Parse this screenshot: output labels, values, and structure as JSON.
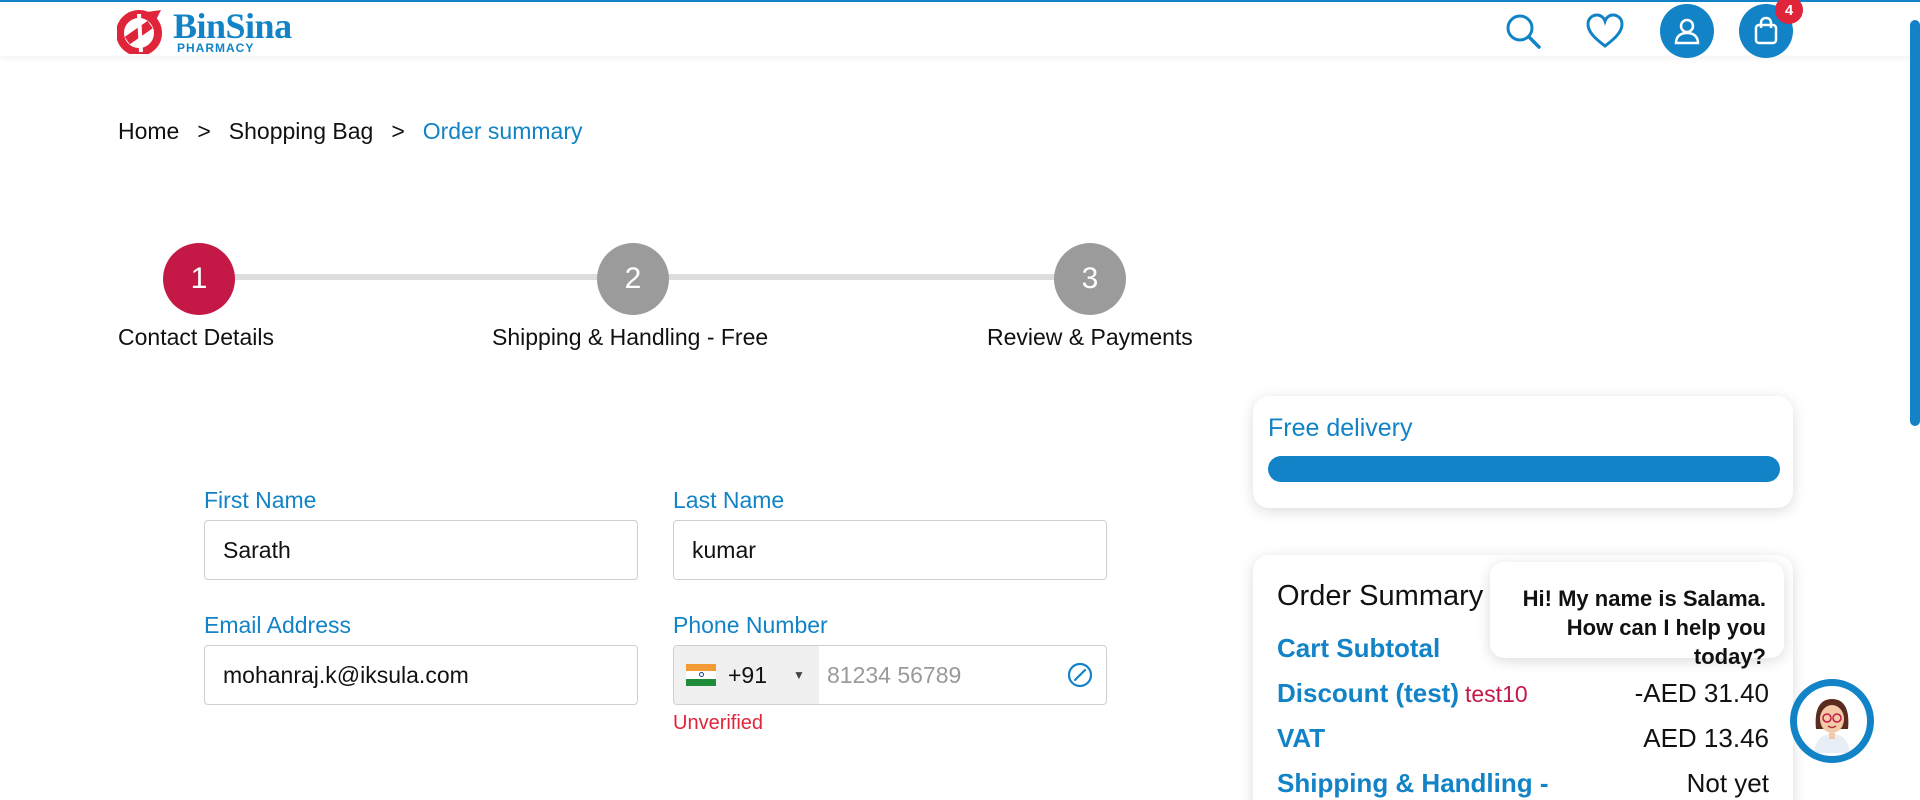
{
  "header": {
    "brand_name": "BinSina",
    "brand_sub": "PHARMACY",
    "cart_count": "4",
    "icons": [
      "search-icon",
      "heart-icon",
      "user-icon",
      "shopping-bag-icon"
    ]
  },
  "breadcrumb": {
    "items": [
      "Home",
      "Shopping Bag",
      "Order summary"
    ],
    "separator": ">"
  },
  "stepper": {
    "steps": [
      {
        "number": "1",
        "label": "Contact Details",
        "state": "active"
      },
      {
        "number": "2",
        "label": "Shipping & Handling - Free",
        "state": "inactive"
      },
      {
        "number": "3",
        "label": "Review & Payments",
        "state": "inactive"
      }
    ]
  },
  "form": {
    "first_name": {
      "label": "First Name",
      "value": "Sarath"
    },
    "last_name": {
      "label": "Last Name",
      "value": "kumar"
    },
    "email": {
      "label": "Email Address",
      "value": "mohanraj.k@iksula.com"
    },
    "phone": {
      "label": "Phone Number",
      "country_code": "+91",
      "placeholder": "81234 56789",
      "status": "Unverified"
    }
  },
  "free_delivery": {
    "title": "Free delivery",
    "progress_percent": 100
  },
  "order_summary": {
    "title": "Order Summary",
    "rows": [
      {
        "label": "Cart Subtotal",
        "code": "",
        "value": ""
      },
      {
        "label": "Discount (test)",
        "code": "test10",
        "value": "-AED 31.40"
      },
      {
        "label": "VAT",
        "code": "",
        "value": "AED 13.46"
      },
      {
        "label": "Shipping & Handling -",
        "code": "",
        "value": "Not yet"
      }
    ]
  },
  "chat": {
    "message": "Hi! My name is Salama. How can I help you today?"
  },
  "colors": {
    "brand_blue": "#1183c6",
    "step_active": "#c41947",
    "step_inactive": "#9b9b9b",
    "error_red": "#e0253b"
  }
}
